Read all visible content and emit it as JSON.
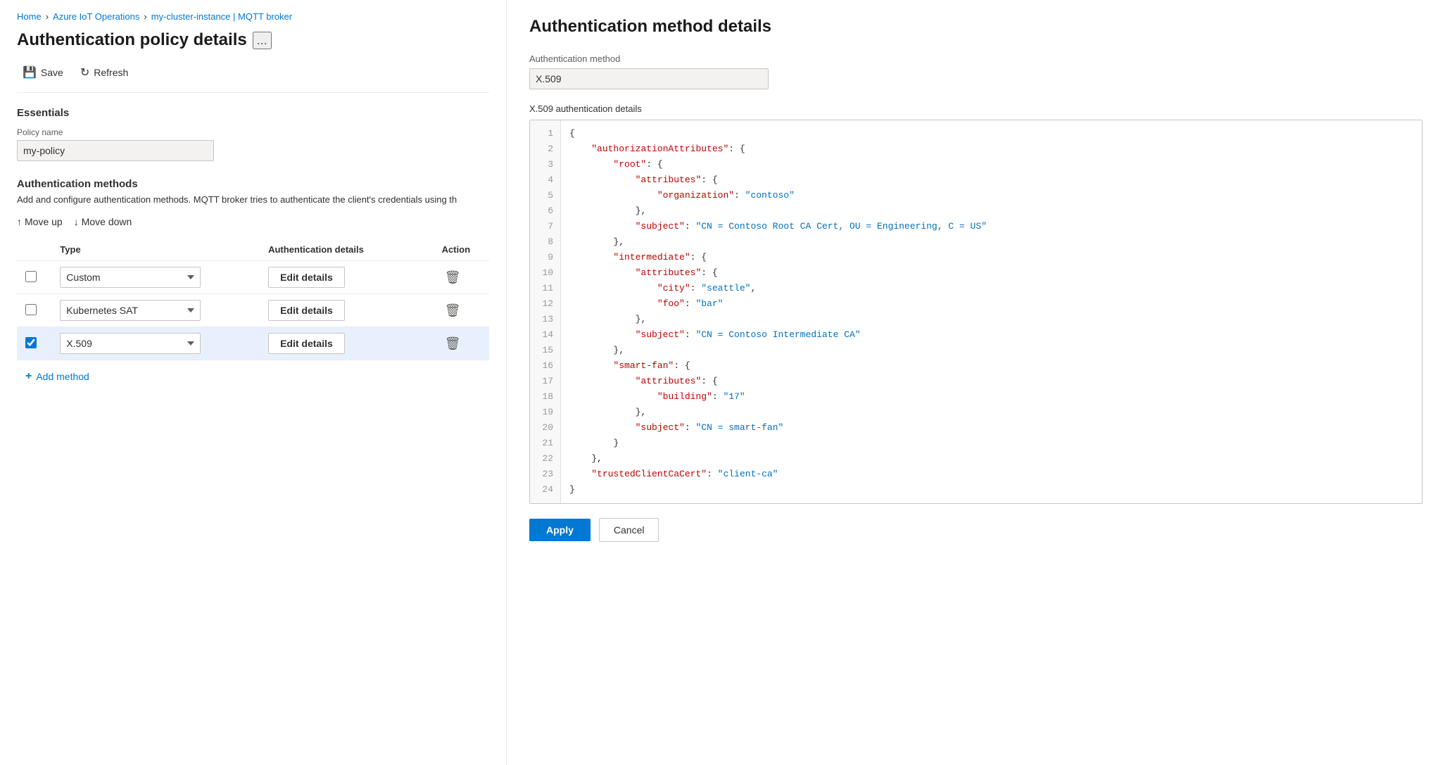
{
  "breadcrumb": {
    "items": [
      {
        "label": "Home",
        "href": "#"
      },
      {
        "label": "Azure IoT Operations",
        "href": "#"
      },
      {
        "label": "my-cluster-instance | MQTT broker",
        "href": "#"
      }
    ]
  },
  "left": {
    "page_title": "Authentication policy details",
    "more_button_label": "...",
    "toolbar": {
      "save_label": "Save",
      "refresh_label": "Refresh"
    },
    "essentials": {
      "section_title": "Essentials",
      "policy_name_label": "Policy name",
      "policy_name_value": "my-policy"
    },
    "auth_methods": {
      "section_title": "Authentication methods",
      "description": "Add and configure authentication methods. MQTT broker tries to authenticate the client's credentials using th",
      "move_up_label": "Move up",
      "move_down_label": "Move down",
      "table_headers": {
        "type": "Type",
        "auth_details": "Authentication details",
        "action": "Action"
      },
      "rows": [
        {
          "id": 1,
          "checked": false,
          "type": "Custom",
          "edit_label": "Edit details"
        },
        {
          "id": 2,
          "checked": false,
          "type": "Kubernetes SAT",
          "edit_label": "Edit details"
        },
        {
          "id": 3,
          "checked": true,
          "type": "X.509",
          "edit_label": "Edit details"
        }
      ],
      "add_method_label": "Add method"
    }
  },
  "right": {
    "panel_title": "Authentication method details",
    "auth_method_label": "Authentication method",
    "auth_method_value": "X.509",
    "x509_label": "X.509 authentication details",
    "code_lines": [
      {
        "num": 1,
        "text": "{"
      },
      {
        "num": 2,
        "text": "    \"authorizationAttributes\": {"
      },
      {
        "num": 3,
        "text": "        \"root\": {"
      },
      {
        "num": 4,
        "text": "            \"attributes\": {"
      },
      {
        "num": 5,
        "text": "                \"organization\": \"contoso\""
      },
      {
        "num": 6,
        "text": "            },"
      },
      {
        "num": 7,
        "text": "            \"subject\": \"CN = Contoso Root CA Cert, OU = Engineering, C = US\""
      },
      {
        "num": 8,
        "text": "        },"
      },
      {
        "num": 9,
        "text": "        \"intermediate\": {"
      },
      {
        "num": 10,
        "text": "            \"attributes\": {"
      },
      {
        "num": 11,
        "text": "                \"city\": \"seattle\","
      },
      {
        "num": 12,
        "text": "                \"foo\": \"bar\""
      },
      {
        "num": 13,
        "text": "            },"
      },
      {
        "num": 14,
        "text": "            \"subject\": \"CN = Contoso Intermediate CA\""
      },
      {
        "num": 15,
        "text": "        },"
      },
      {
        "num": 16,
        "text": "        \"smart-fan\": {"
      },
      {
        "num": 17,
        "text": "            \"attributes\": {"
      },
      {
        "num": 18,
        "text": "                \"building\": \"17\""
      },
      {
        "num": 19,
        "text": "            },"
      },
      {
        "num": 20,
        "text": "            \"subject\": \"CN = smart-fan\""
      },
      {
        "num": 21,
        "text": "        }"
      },
      {
        "num": 22,
        "text": "    },"
      },
      {
        "num": 23,
        "text": "    \"trustedClientCaCert\": \"client-ca\""
      },
      {
        "num": 24,
        "text": "}"
      }
    ],
    "apply_label": "Apply",
    "cancel_label": "Cancel"
  }
}
